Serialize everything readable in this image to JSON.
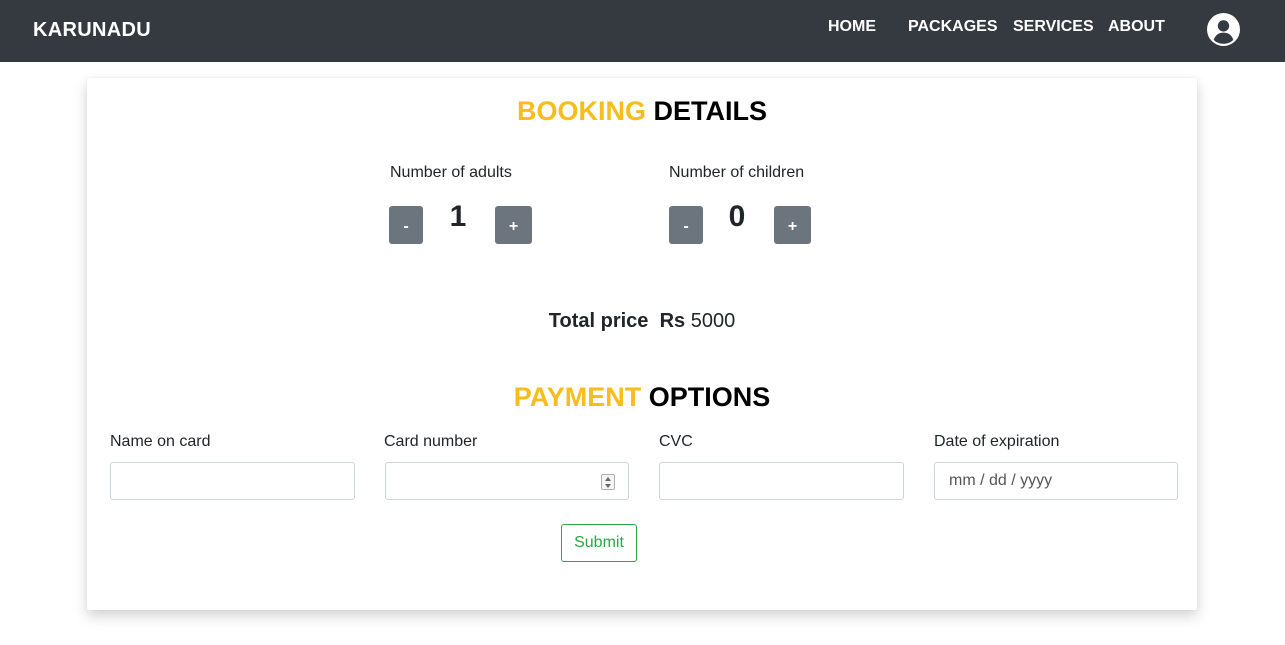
{
  "navbar": {
    "brand": "KARUNADU",
    "links": [
      {
        "label": "HOME"
      },
      {
        "label": "PACKAGES"
      },
      {
        "label": "SERVICES"
      },
      {
        "label": "ABOUT"
      }
    ],
    "profile_icon": "user-circle-icon"
  },
  "booking": {
    "title_accent": "BOOKING",
    "title_rest": "DETAILS",
    "adults": {
      "label": "Number of adults",
      "value": "1",
      "minus": "-",
      "plus": "+"
    },
    "children": {
      "label": "Number of children",
      "value": "0",
      "minus": "-",
      "plus": "+"
    },
    "total": {
      "label": "Total price",
      "currency": "Rs",
      "amount": "5000"
    }
  },
  "payment": {
    "title_accent": "PAYMENT",
    "title_rest": "OPTIONS",
    "name_label": "Name on card",
    "name_value": "",
    "card_label": "Card number",
    "card_value": "",
    "cvc_label": "CVC",
    "cvc_value": "",
    "expiry_label": "Date of expiration",
    "expiry_placeholder": "mm / dd / yyyy",
    "submit_label": "Submit"
  },
  "colors": {
    "navbar_bg": "#343a40",
    "accent": "#f7bd1b",
    "stepper_bg": "#6c757d",
    "submit_outline": "#28a745"
  }
}
